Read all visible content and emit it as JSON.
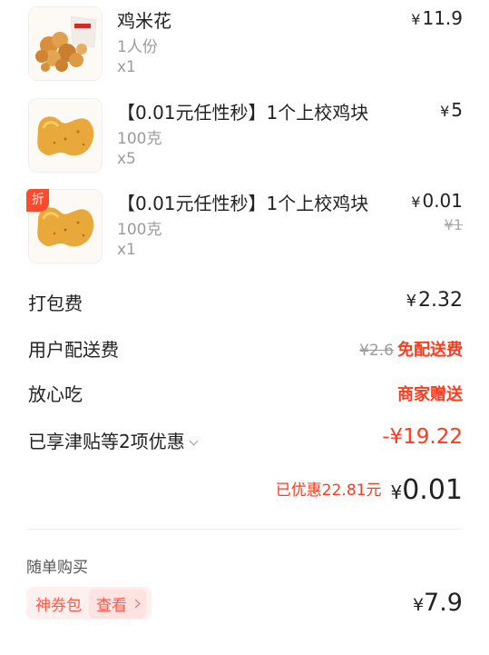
{
  "items": [
    {
      "name": "鸡米花",
      "spec": "1人份",
      "qty": "x1",
      "currency": "¥",
      "price": "11.9",
      "image": "popcorn-chicken-photo"
    },
    {
      "name": "【0.01元任性秒】1个上校鸡块",
      "spec": "100克",
      "qty": "x5",
      "currency": "¥",
      "price": "5",
      "image": "chicken-nugget-photo"
    },
    {
      "name": "【0.01元任性秒】1个上校鸡块",
      "spec": "100克",
      "qty": "x1",
      "currency": "¥",
      "price": "0.01",
      "original_price": "¥1",
      "badge": "折",
      "image": "chicken-nugget-photo"
    }
  ],
  "fees": {
    "packing_label": "打包费",
    "packing_currency": "¥",
    "packing_value": "2.32",
    "delivery_label": "用户配送费",
    "delivery_original": "¥2.6",
    "delivery_free": "免配送费",
    "worry_free_label": "放心吃",
    "worry_free_value": "商家赠送",
    "discount_label": "已享津贴等2项优惠",
    "discount_value": "-¥19.22"
  },
  "total": {
    "saved_text": "已优惠22.81元",
    "currency": "¥",
    "amount": "0.01"
  },
  "addon": {
    "section_title": "随单购买",
    "coupon_name": "神券包",
    "view_label": "查看",
    "currency": "¥",
    "price": "7.9"
  },
  "colors": {
    "accent_red": "#ff3b1f",
    "pill_bg": "#fff0f0"
  }
}
